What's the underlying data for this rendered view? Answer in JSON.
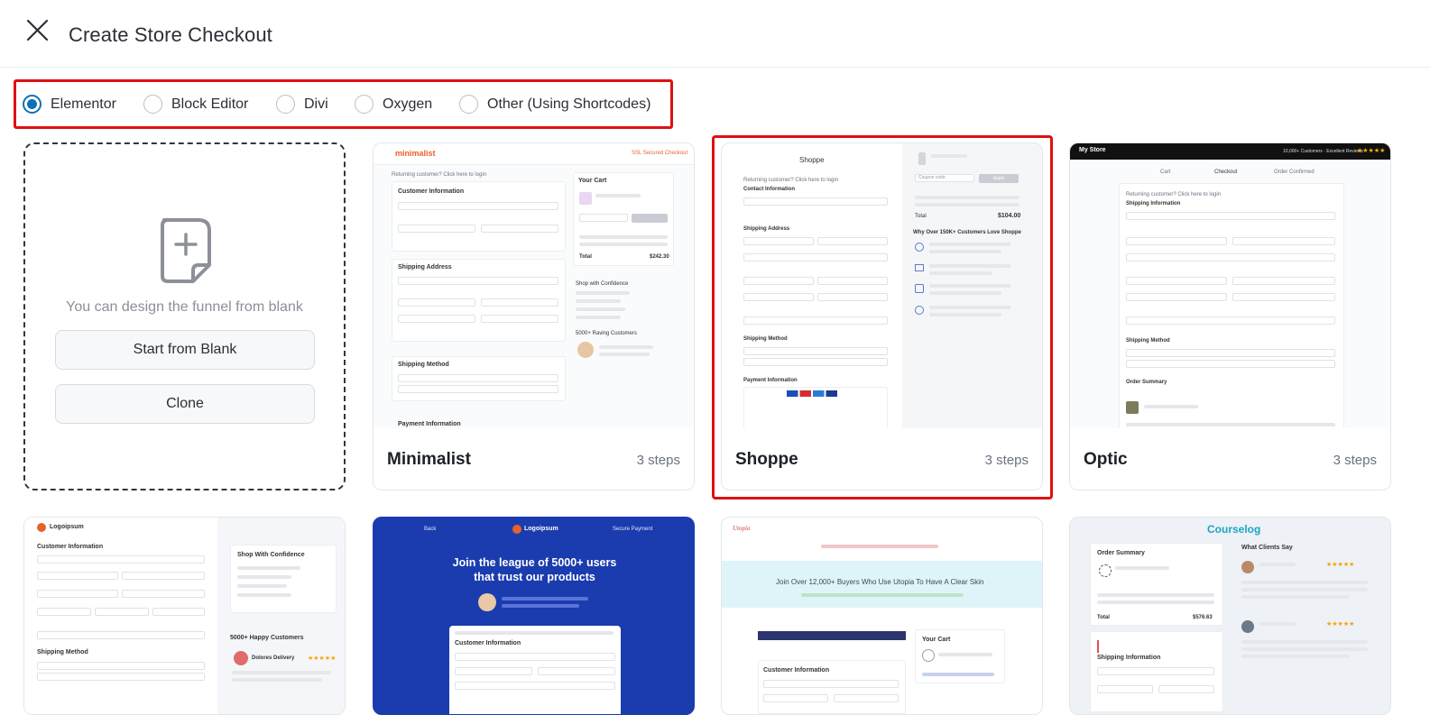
{
  "header": {
    "title": "Create Store Checkout"
  },
  "builders": [
    {
      "label": "Elementor",
      "checked": true
    },
    {
      "label": "Block Editor",
      "checked": false
    },
    {
      "label": "Divi",
      "checked": false
    },
    {
      "label": "Oxygen",
      "checked": false
    },
    {
      "label": "Other (Using Shortcodes)",
      "checked": false
    }
  ],
  "blank": {
    "text": "You can design the funnel from blank",
    "start_label": "Start from Blank",
    "clone_label": "Clone"
  },
  "templates": [
    {
      "name": "Minimalist",
      "steps": "3 steps",
      "selected": false
    },
    {
      "name": "Shoppe",
      "steps": "3 steps",
      "selected": true
    },
    {
      "name": "Optic",
      "steps": "3 steps",
      "selected": false
    }
  ],
  "previews": {
    "minimalist": {
      "logo": "minimalist",
      "badge": "SSL Secured Checkout",
      "returning": "Returning customer? Click here to login",
      "customer_info": "Customer Information",
      "shipping_address": "Shipping Address",
      "shipping_method": "Shipping Method",
      "payment_info": "Payment Information",
      "cart_title": "Your Cart",
      "total_label": "Total",
      "total_value": "$242.30",
      "confidence": "Shop with Confidence",
      "customers": "5000+ Raving Customers"
    },
    "shoppe": {
      "logo": "Shoppe",
      "returning": "Returning customer? Click here to login",
      "contact": "Contact Information",
      "shipping_address": "Shipping Address",
      "shipping_method": "Shipping Method",
      "payment_info": "Payment Information",
      "total_label": "Total",
      "total_value": "$104.00",
      "why": "Why Over 150K+ Customers Love Shoppe",
      "coupon": "Coupon code",
      "apply": "Apply"
    },
    "optic": {
      "logo": "My Store",
      "review": "10,000+ Customers · Excellent Reviews",
      "steps": [
        "Cart",
        "Checkout",
        "Order Confirmed"
      ],
      "returning": "Returning customer? Click here to login",
      "shipping_info": "Shipping Information",
      "shipping_method": "Shipping Method",
      "order_summary": "Order Summary"
    },
    "row2_a": {
      "logo": "Logoipsum",
      "customer_info": "Customer Information",
      "confidence": "Shop With Confidence",
      "happy": "5000+ Happy Customers",
      "shipping_method": "Shipping Method",
      "reviewer": "Dolores Delivery"
    },
    "row2_b": {
      "logo": "Logoipsum",
      "back": "Back",
      "secure": "Secure Payment",
      "headline1": "Join the league of 5000+ users",
      "headline2": "that trust our products",
      "customer_info": "Customer Information"
    },
    "row2_c": {
      "logo": "Utopia",
      "headline": "Join Over 12,000+ Buyers Who Use Utopia To Have A Clear Skin",
      "customer_info": "Customer Information",
      "cart": "Your Cart"
    },
    "row2_d": {
      "logo": "Courselog",
      "order_summary": "Order Summary",
      "clients": "What Clients Say",
      "shipping_info": "Shipping Information",
      "total_label": "Total",
      "total_value": "$576.63"
    }
  }
}
